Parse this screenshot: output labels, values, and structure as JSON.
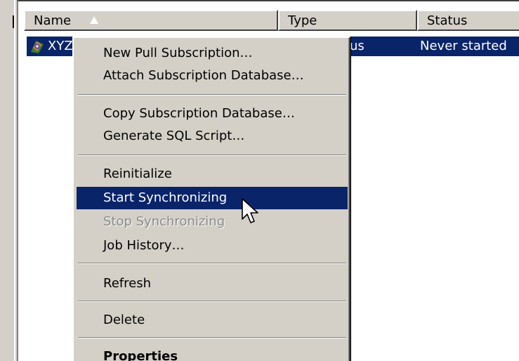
{
  "listview": {
    "columns": [
      "Name",
      "Type",
      "Status"
    ],
    "sort_icon": "sort-ascending-icon",
    "row": {
      "icon": "subscription-icon",
      "name": "XYZ",
      "type_partial": "us",
      "status": "Never started"
    }
  },
  "context_menu": {
    "items": [
      {
        "label": "New Pull Subscription…",
        "state": "normal"
      },
      {
        "label": "Attach Subscription Database…",
        "state": "normal"
      },
      {
        "label": "Copy Subscription Database…",
        "state": "normal"
      },
      {
        "label": "Generate SQL Script…",
        "state": "normal"
      },
      {
        "label": "Reinitialize",
        "state": "normal"
      },
      {
        "label": "Start Synchronizing",
        "state": "highlighted"
      },
      {
        "label": "Stop Synchronizing",
        "state": "disabled"
      },
      {
        "label": "Job History…",
        "state": "normal"
      },
      {
        "label": "Refresh",
        "state": "normal"
      },
      {
        "label": "Delete",
        "state": "normal"
      },
      {
        "label": "Properties",
        "state": "bold"
      }
    ]
  },
  "cursor": "arrow-pointer-icon",
  "colors": {
    "selection": "#0a246a",
    "face": "#d4d0c8",
    "disabled_text": "#8a8a8a"
  }
}
